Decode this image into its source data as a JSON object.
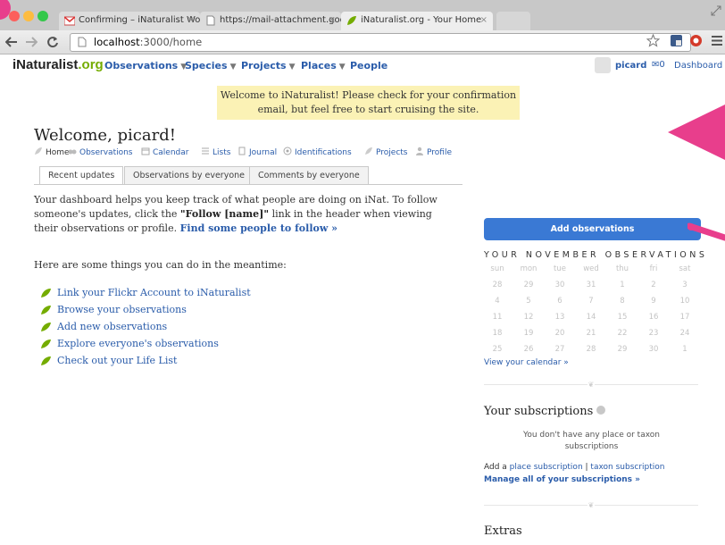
{
  "browser": {
    "tabs": [
      {
        "title": "Confirming – iNaturalist Wor",
        "favicon": "gmail-icon"
      },
      {
        "title": "https://mail-attachment.goo",
        "favicon": "page-icon"
      },
      {
        "title": "iNaturalist.org - Your Home",
        "favicon": "leaf-icon",
        "active": true
      }
    ],
    "url_host": "localhost",
    "url_path": ":3000/home",
    "close_glyph": "×"
  },
  "site": {
    "logo_prefix": "iNaturalist",
    "logo_suffix": ".org",
    "nav": [
      "Observations",
      "Species",
      "Projects",
      "Places",
      "People"
    ],
    "user": {
      "name": "picard",
      "messages": "0",
      "dashboard": "Dashboard"
    }
  },
  "flash": "Welcome to iNaturalist! Please check for your confirmation email, but feel free to start cruising the site.",
  "page": {
    "title": "Welcome, picard!",
    "subnav": [
      "Home",
      "Observations",
      "Calendar",
      "Lists",
      "Journal",
      "Identifications",
      "Projects",
      "Profile"
    ],
    "tabs": [
      "Recent updates",
      "Observations by everyone",
      "Comments by everyone"
    ],
    "intro_1": "Your dashboard helps you keep track of what people are doing on iNat. To follow someone's updates, click the ",
    "intro_bold": "\"Follow [name]\"",
    "intro_2": " link in the header when viewing their observations or profile. ",
    "intro_link": "Find some people to follow »",
    "meantime": "Here are some things you can do in the meantime:",
    "todo": [
      "Link your Flickr Account to iNaturalist",
      "Browse your observations",
      "Add new observations",
      "Explore everyone's observations",
      "Check out your Life List"
    ]
  },
  "sidebar": {
    "add_button": "Add observations",
    "calendar_title": "YOUR NOVEMBER OBSERVATIONS",
    "weekdays": [
      "sun",
      "mon",
      "tue",
      "wed",
      "thu",
      "fri",
      "sat"
    ],
    "weeks": [
      [
        "28",
        "29",
        "30",
        "31",
        "1",
        "2",
        "3"
      ],
      [
        "4",
        "5",
        "6",
        "7",
        "8",
        "9",
        "10"
      ],
      [
        "11",
        "12",
        "13",
        "14",
        "15",
        "16",
        "17"
      ],
      [
        "18",
        "19",
        "20",
        "21",
        "22",
        "23",
        "24"
      ],
      [
        "25",
        "26",
        "27",
        "28",
        "29",
        "30",
        "1"
      ]
    ],
    "view_calendar": "View your calendar »",
    "subscriptions_title": "Your subscriptions",
    "no_subscriptions": "You don't have any place or taxon subscriptions",
    "add_prefix": "Add a ",
    "place_sub": "place subscription",
    "sub_sep": " | ",
    "taxon_sub": "taxon subscription",
    "manage": "Manage all of your subscriptions »",
    "extras": "Extras"
  },
  "colors": {
    "accent": "#74ac00",
    "link": "#2a5caa",
    "button": "#3a79d4",
    "flash_bg": "#fbf2b5",
    "annotation": "#e83e8c"
  }
}
